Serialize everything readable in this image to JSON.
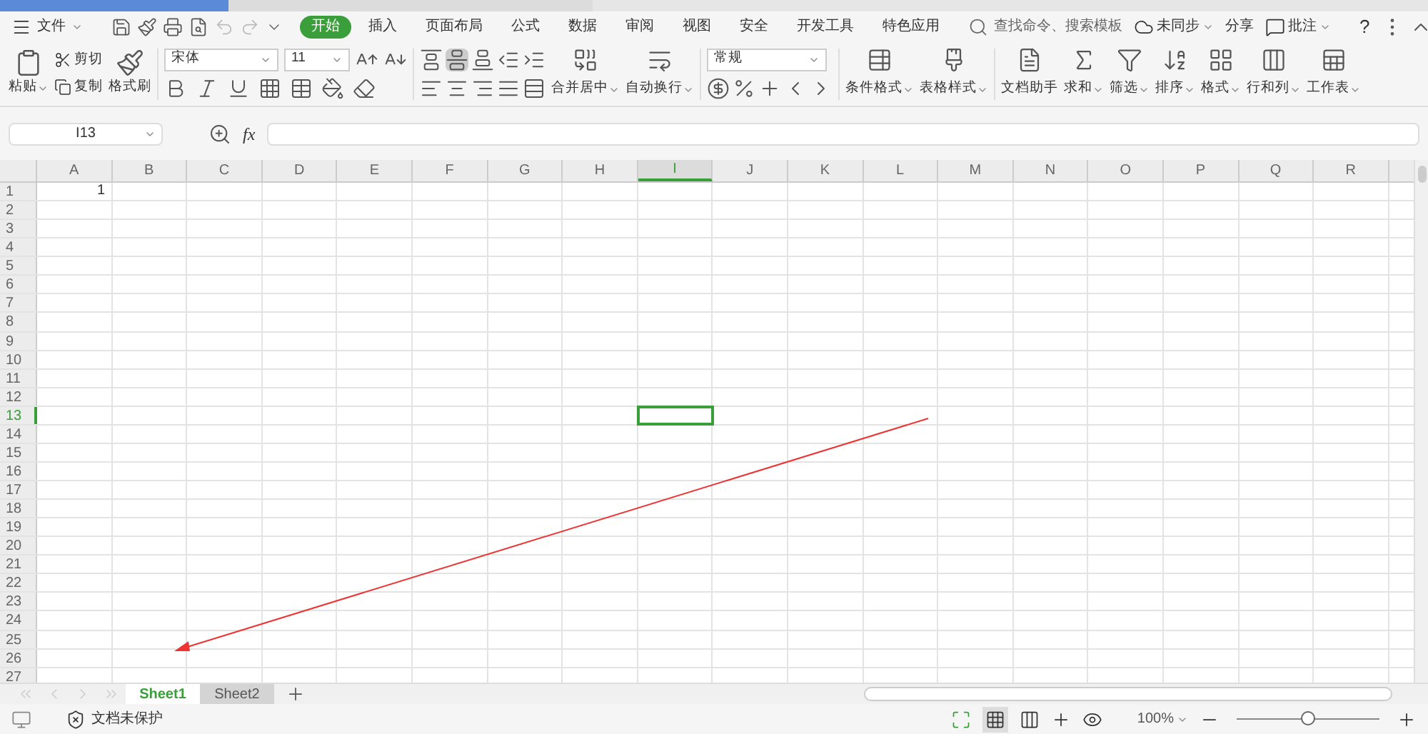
{
  "menu": {
    "file": "文件",
    "tabs": [
      {
        "label": "开始",
        "selected": true
      },
      {
        "label": "插入",
        "selected": false
      },
      {
        "label": "页面布局",
        "selected": false
      },
      {
        "label": "公式",
        "selected": false
      },
      {
        "label": "数据",
        "selected": false
      },
      {
        "label": "审阅",
        "selected": false
      },
      {
        "label": "视图",
        "selected": false
      },
      {
        "label": "安全",
        "selected": false
      },
      {
        "label": "开发工具",
        "selected": false
      },
      {
        "label": "特色应用",
        "selected": false
      }
    ],
    "search": {
      "placeholder": "查找命令、搜索模板"
    },
    "sync": "未同步",
    "share": "分享",
    "comment": "批注",
    "help": "?"
  },
  "ribbon": {
    "paste": "粘贴",
    "cut": "剪切",
    "copy": "复制",
    "format_painter": "格式刷",
    "font_name": "宋体",
    "font_size": "11",
    "number_format": "常规",
    "buttons": [
      {
        "kind": "merge",
        "label": "合并居中"
      },
      {
        "kind": "wrap",
        "label": "自动换行"
      },
      {
        "kind": "cond",
        "label": "条件格式"
      },
      {
        "kind": "style",
        "label": "表格样式"
      },
      {
        "kind": "doc",
        "label": "文档助手"
      },
      {
        "kind": "sum",
        "label": "求和"
      },
      {
        "kind": "filter",
        "label": "筛选"
      },
      {
        "kind": "sort",
        "label": "排序"
      },
      {
        "kind": "format",
        "label": "格式"
      },
      {
        "kind": "rowcol",
        "label": "行和列"
      },
      {
        "kind": "sheet",
        "label": "工作表"
      }
    ]
  },
  "formula_bar": {
    "name_box": "I13",
    "fx": "fx"
  },
  "sheet": {
    "columns": [
      {
        "label": "A",
        "selected": false
      },
      {
        "label": "B",
        "selected": false
      },
      {
        "label": "C",
        "selected": false
      },
      {
        "label": "D",
        "selected": false
      },
      {
        "label": "E",
        "selected": false
      },
      {
        "label": "F",
        "selected": false
      },
      {
        "label": "G",
        "selected": false
      },
      {
        "label": "H",
        "selected": false
      },
      {
        "label": "I",
        "selected": true
      },
      {
        "label": "J",
        "selected": false
      },
      {
        "label": "K",
        "selected": false
      },
      {
        "label": "L",
        "selected": false
      },
      {
        "label": "M",
        "selected": false
      },
      {
        "label": "N",
        "selected": false
      },
      {
        "label": "O",
        "selected": false
      },
      {
        "label": "P",
        "selected": false
      },
      {
        "label": "Q",
        "selected": false
      },
      {
        "label": "R",
        "selected": false
      }
    ],
    "rows": [
      {
        "label": "1",
        "selected": false,
        "cells": [
          "1"
        ]
      },
      {
        "label": "2",
        "selected": false
      },
      {
        "label": "3",
        "selected": false
      },
      {
        "label": "4",
        "selected": false
      },
      {
        "label": "5",
        "selected": false
      },
      {
        "label": "6",
        "selected": false
      },
      {
        "label": "7",
        "selected": false
      },
      {
        "label": "8",
        "selected": false
      },
      {
        "label": "9",
        "selected": false
      },
      {
        "label": "10",
        "selected": false
      },
      {
        "label": "11",
        "selected": false
      },
      {
        "label": "12",
        "selected": false
      },
      {
        "label": "13",
        "selected": true
      },
      {
        "label": "14",
        "selected": false
      },
      {
        "label": "15",
        "selected": false
      },
      {
        "label": "16",
        "selected": false
      },
      {
        "label": "17",
        "selected": false
      },
      {
        "label": "18",
        "selected": false
      },
      {
        "label": "19",
        "selected": false
      },
      {
        "label": "20",
        "selected": false
      },
      {
        "label": "21",
        "selected": false
      },
      {
        "label": "22",
        "selected": false
      },
      {
        "label": "23",
        "selected": false
      },
      {
        "label": "24",
        "selected": false
      },
      {
        "label": "25",
        "selected": false
      },
      {
        "label": "26",
        "selected": false
      },
      {
        "label": "27",
        "selected": false
      }
    ]
  },
  "sheet_tabs": [
    {
      "label": "Sheet1",
      "selected": true
    },
    {
      "label": "Sheet2",
      "selected": false
    }
  ],
  "status_bar": {
    "protection": "文档未保护",
    "zoom": "100%",
    "zoom_slider": {
      "level": 0.5
    }
  }
}
